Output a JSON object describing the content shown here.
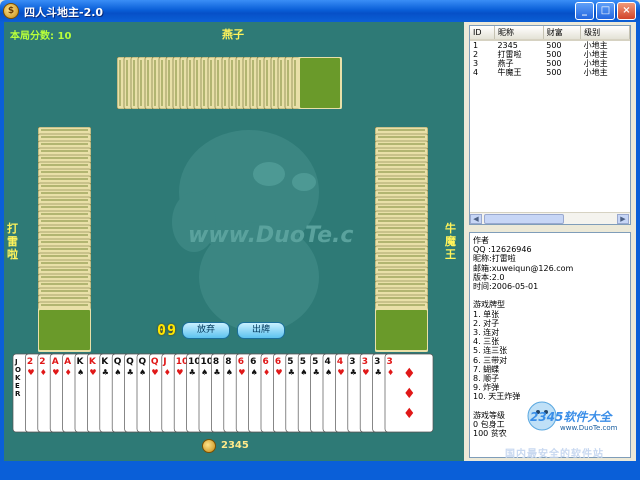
{
  "window": {
    "title": "四人斗地主-2.0",
    "minimize_label": "_",
    "maximize_label": "□",
    "close_label": "×"
  },
  "game": {
    "score_label": "本局分数: 10",
    "player_top": "燕子",
    "player_left": "打雷啦",
    "player_right": "牛魔王",
    "player_self": "2345",
    "timer": "09",
    "pass_button": "放弃",
    "play_button": "出牌",
    "watermark": "www.DuoTe.com",
    "hand_cards": [
      {
        "rank": "JOKER",
        "color": "black",
        "suit": "",
        "selected": false
      },
      {
        "rank": "2",
        "color": "red",
        "suit": "♥",
        "selected": false
      },
      {
        "rank": "2",
        "color": "red",
        "suit": "♦",
        "selected": false
      },
      {
        "rank": "A",
        "color": "red",
        "suit": "♥",
        "selected": false
      },
      {
        "rank": "A",
        "color": "red",
        "suit": "♦",
        "selected": false
      },
      {
        "rank": "K",
        "color": "black",
        "suit": "♠",
        "selected": false
      },
      {
        "rank": "K",
        "color": "red",
        "suit": "♥",
        "selected": false
      },
      {
        "rank": "K",
        "color": "black",
        "suit": "♣",
        "selected": false
      },
      {
        "rank": "Q",
        "color": "black",
        "suit": "♠",
        "selected": false
      },
      {
        "rank": "Q",
        "color": "black",
        "suit": "♣",
        "selected": false
      },
      {
        "rank": "Q",
        "color": "black",
        "suit": "♠",
        "selected": false
      },
      {
        "rank": "Q",
        "color": "red",
        "suit": "♥",
        "selected": false
      },
      {
        "rank": "J",
        "color": "red",
        "suit": "♦",
        "selected": false
      },
      {
        "rank": "10",
        "color": "red",
        "suit": "♥",
        "selected": false
      },
      {
        "rank": "10",
        "color": "black",
        "suit": "♣",
        "selected": false
      },
      {
        "rank": "10",
        "color": "black",
        "suit": "♠",
        "selected": false
      },
      {
        "rank": "8",
        "color": "black",
        "suit": "♣",
        "selected": false
      },
      {
        "rank": "8",
        "color": "black",
        "suit": "♠",
        "selected": false
      },
      {
        "rank": "6",
        "color": "red",
        "suit": "♥",
        "selected": false
      },
      {
        "rank": "6",
        "color": "black",
        "suit": "♠",
        "selected": false
      },
      {
        "rank": "6",
        "color": "red",
        "suit": "♦",
        "selected": false
      },
      {
        "rank": "6",
        "color": "red",
        "suit": "♥",
        "selected": false
      },
      {
        "rank": "5",
        "color": "black",
        "suit": "♣",
        "selected": false
      },
      {
        "rank": "5",
        "color": "black",
        "suit": "♠",
        "selected": false
      },
      {
        "rank": "5",
        "color": "black",
        "suit": "♣",
        "selected": false
      },
      {
        "rank": "4",
        "color": "black",
        "suit": "♠",
        "selected": false
      },
      {
        "rank": "4",
        "color": "red",
        "suit": "♥",
        "selected": false
      },
      {
        "rank": "3",
        "color": "black",
        "suit": "♣",
        "selected": false
      },
      {
        "rank": "3",
        "color": "red",
        "suit": "♥",
        "selected": false
      },
      {
        "rank": "3",
        "color": "black",
        "suit": "♣",
        "selected": false
      },
      {
        "rank": "3",
        "color": "red",
        "suit": "♦",
        "selected": false
      }
    ]
  },
  "player_list": {
    "headers": [
      "ID",
      "昵称",
      "财富",
      "级别"
    ],
    "rows": [
      [
        "1",
        "2345",
        "500",
        "小地主"
      ],
      [
        "2",
        "打雷啦",
        "500",
        "小地主"
      ],
      [
        "3",
        "燕子",
        "500",
        "小地主"
      ],
      [
        "4",
        "牛魔王",
        "500",
        "小地主"
      ]
    ]
  },
  "info_panel": {
    "lines": [
      "作者",
      "QQ  :12626946",
      "昵称:打雷啦",
      "邮箱:xuweiqun@126.com",
      "版本:2.0",
      "时间:2006-05-01",
      "",
      "游戏牌型",
      "1.  单张",
      "2.  对子",
      "3.  连对",
      "4.  三张",
      "5.  连三张",
      "6.  三带对",
      "7.  蝴蝶",
      "8.  顺子",
      "9.  炸弹",
      "10. 天王炸弹",
      "",
      "游戏等级",
      "0          包身工",
      "100        贫农"
    ]
  },
  "branding": {
    "logo": "2345软件大全",
    "site": "www.DuoTe.com",
    "bottom": "国内最安全的软件站"
  },
  "colors": {
    "table": "#2e7a76",
    "titlebar": "#0a5fd8",
    "accent_yellow": "#fff35a"
  }
}
